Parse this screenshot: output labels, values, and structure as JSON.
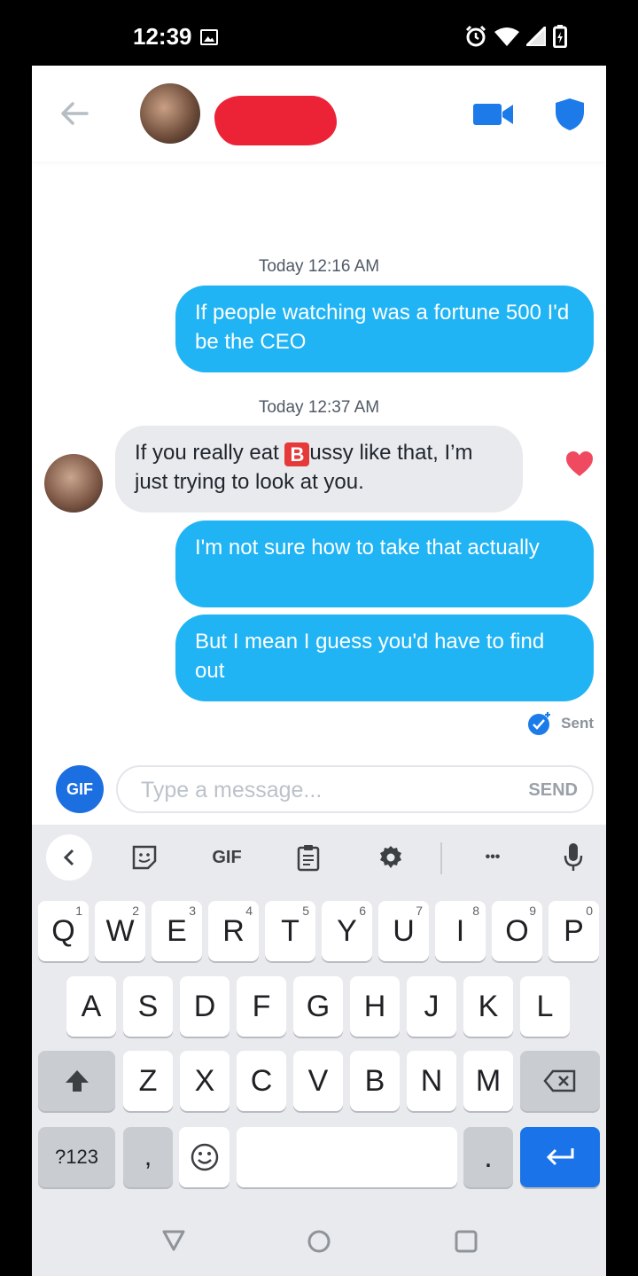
{
  "status_bar": {
    "time": "12:39"
  },
  "header": {
    "back_icon": "arrow-left-icon",
    "video_icon": "video-camera-icon",
    "shield_icon": "shield-icon"
  },
  "messages": {
    "timestamp_1": {
      "day": "Today",
      "time": "12:16 AM"
    },
    "out_1": "If people watching was a fortune 500 I'd be the CEO",
    "timestamp_2": {
      "day": "Today",
      "time": "12:37 AM"
    },
    "in_1_pre": "If you really eat ",
    "in_1_badge": "B",
    "in_1_post": "ussy like that, I’m just trying to look at you.",
    "out_2": "I'm not sure how to take that actually",
    "out_3": "But I mean I guess you'd have to find out",
    "sent_label": "Sent"
  },
  "composer": {
    "gif_label": "GIF",
    "placeholder": "Type a message...",
    "send_label": "SEND"
  },
  "keyboard": {
    "toolbar_gif": "GIF",
    "toolbar_more": "•••",
    "row1": [
      {
        "k": "Q",
        "n": "1"
      },
      {
        "k": "W",
        "n": "2"
      },
      {
        "k": "E",
        "n": "3"
      },
      {
        "k": "R",
        "n": "4"
      },
      {
        "k": "T",
        "n": "5"
      },
      {
        "k": "Y",
        "n": "6"
      },
      {
        "k": "U",
        "n": "7"
      },
      {
        "k": "I",
        "n": "8"
      },
      {
        "k": "O",
        "n": "9"
      },
      {
        "k": "P",
        "n": "0"
      }
    ],
    "row2": [
      "A",
      "S",
      "D",
      "F",
      "G",
      "H",
      "J",
      "K",
      "L"
    ],
    "row3": [
      "Z",
      "X",
      "C",
      "V",
      "B",
      "N",
      "M"
    ],
    "symbols": "?123",
    "comma": ",",
    "period": "."
  },
  "colors": {
    "outgoing": "#20b4f4",
    "incoming": "#e8eaed",
    "accent": "#1a73e8",
    "heart": "#ef4a5f"
  }
}
